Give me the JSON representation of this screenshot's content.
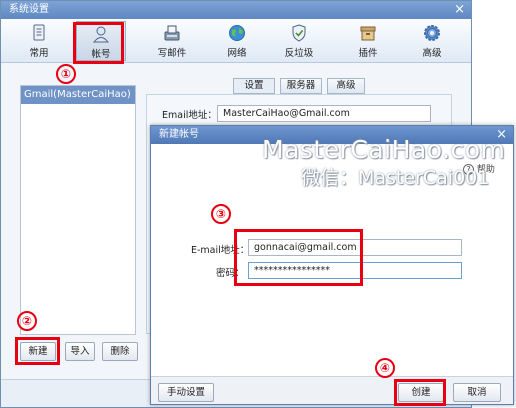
{
  "main_window": {
    "title": "系统设置",
    "close_glyph": "×",
    "toolbar": [
      {
        "label": "常用",
        "icon": "document-icon"
      },
      {
        "label": "帐号",
        "icon": "user-icon"
      },
      {
        "label": "写邮件",
        "icon": "compose-icon"
      },
      {
        "label": "网络",
        "icon": "globe-icon"
      },
      {
        "label": "反垃圾",
        "icon": "shield-icon"
      },
      {
        "label": "插件",
        "icon": "plugin-box-icon"
      },
      {
        "label": "高级",
        "icon": "gear-icon"
      }
    ],
    "account_list": [
      "Gmail(MasterCaiHao)"
    ],
    "buttons": {
      "new": "新建",
      "import": "导入",
      "delete": "删除"
    },
    "settings_tabs": [
      "设置",
      "服务器",
      "高级"
    ],
    "email_label": "Email地址：",
    "email_value": "MasterCaiHao@Gmail.com"
  },
  "dialog": {
    "title": "新建帐号",
    "close_glyph": "×",
    "email_label": "E-mail地址：",
    "email_value": "gonnacai@gmail.com",
    "password_label": "密码：",
    "password_value": "****************",
    "help_label": "帮助",
    "help_glyph": "?",
    "buttons": {
      "manual": "手动设置",
      "create": "创建",
      "cancel": "取消"
    }
  },
  "annotations": [
    "①",
    "②",
    "③",
    "④"
  ],
  "watermark": {
    "line1": "MasterCaiHao.com",
    "line2": "微信：MasterCai001"
  },
  "colors": {
    "highlight": "#e60012",
    "title_bar": "#5f87c2",
    "selection": "#6f93c6"
  }
}
